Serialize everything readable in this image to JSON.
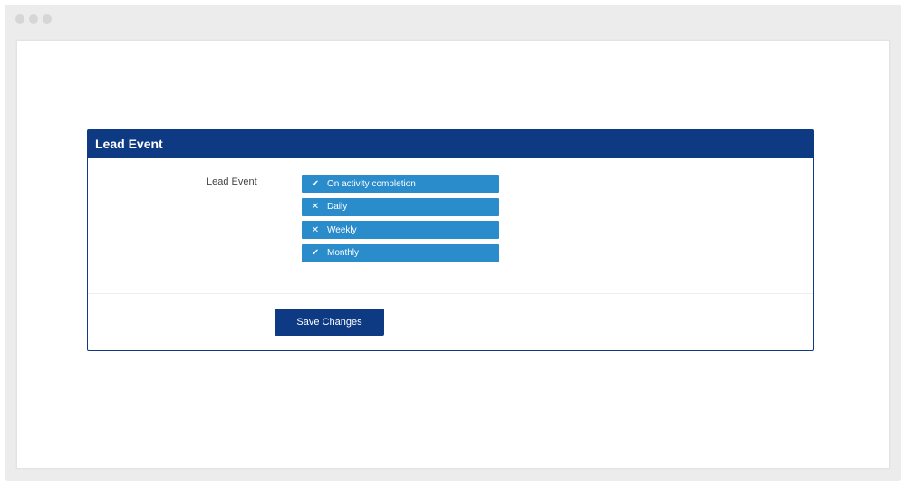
{
  "window": {
    "dots": [
      "window-dot",
      "window-dot",
      "window-dot"
    ]
  },
  "panel": {
    "title": "Lead Event",
    "field_label": "Lead Event",
    "options": [
      {
        "label": "On activity completion",
        "state": "check",
        "icon": "check-icon",
        "glyph": "✔"
      },
      {
        "label": "Daily",
        "state": "cross",
        "icon": "close-icon",
        "glyph": "✕"
      },
      {
        "label": "Weekly",
        "state": "cross",
        "icon": "close-icon",
        "glyph": "✕"
      },
      {
        "label": "Monthly",
        "state": "check",
        "icon": "check-icon",
        "glyph": "✔"
      }
    ],
    "save_label": "Save Changes"
  },
  "colors": {
    "header": "#0e3a83",
    "option": "#2a8ccb",
    "button": "#0e3a83"
  }
}
